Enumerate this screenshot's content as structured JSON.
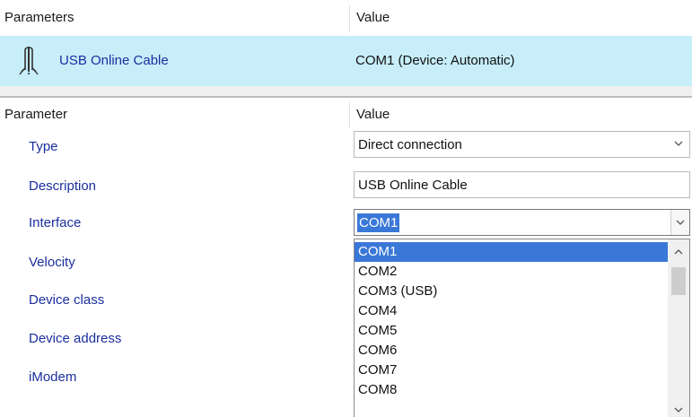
{
  "top_grid": {
    "col_parameters": "Parameters",
    "col_value": "Value",
    "connection": {
      "name": "USB Online Cable",
      "value": "COM1 (Device: Automatic)",
      "icon": "cable-icon"
    }
  },
  "param_grid": {
    "col_parameter": "Parameter",
    "col_value": "Value",
    "rows": [
      {
        "label": "Type",
        "value": "Direct connection"
      },
      {
        "label": "Description",
        "value": "USB Online Cable"
      },
      {
        "label": "Interface",
        "value": "COM1"
      },
      {
        "label": "Velocity"
      },
      {
        "label": "Device class"
      },
      {
        "label": "Device address"
      },
      {
        "label": "iModem"
      }
    ]
  },
  "interface_dropdown": {
    "selected": "COM1",
    "options": [
      "COM1",
      "COM2",
      "COM3  (USB)",
      "COM4",
      "COM5",
      "COM6",
      "COM7",
      "COM8"
    ]
  },
  "colors": {
    "selected_row_bg": "#c7eef9",
    "label_text": "#1b2f9e",
    "selection_blue": "#3a78d8"
  }
}
